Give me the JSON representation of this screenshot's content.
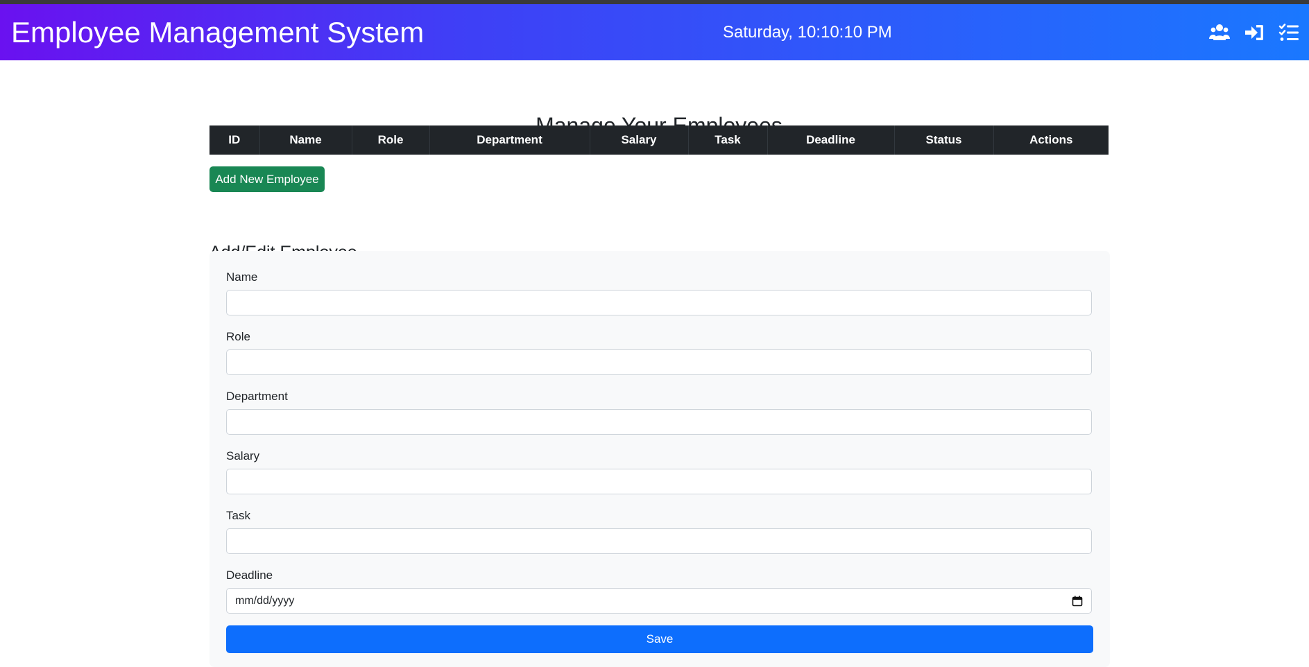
{
  "navbar": {
    "brand": "Employee Management System",
    "datetime": "Saturday, 10:10:10 PM",
    "icons": [
      "users-icon",
      "sign-in-icon",
      "tasks-icon"
    ],
    "gradient": [
      "#6a11f0",
      "#1a78ff"
    ]
  },
  "main": {
    "title": "Manage Your Employees",
    "table": {
      "headers": [
        "ID",
        "Name",
        "Role",
        "Department",
        "Salary",
        "Task",
        "Deadline",
        "Status",
        "Actions"
      ]
    },
    "add_button": "Add New Employee"
  },
  "form": {
    "title": "Add/Edit Employee",
    "fields": {
      "name": {
        "label": "Name",
        "value": ""
      },
      "role": {
        "label": "Role",
        "value": ""
      },
      "department": {
        "label": "Department",
        "value": ""
      },
      "salary": {
        "label": "Salary",
        "value": ""
      },
      "task": {
        "label": "Task",
        "value": ""
      },
      "deadline": {
        "label": "Deadline",
        "placeholder": "mm/dd/yyyy"
      }
    },
    "submit_label": "Save"
  },
  "colors": {
    "table_header": "#212529",
    "success": "#198754",
    "primary": "#0d6efd",
    "form_bg": "#f8f9fa"
  }
}
